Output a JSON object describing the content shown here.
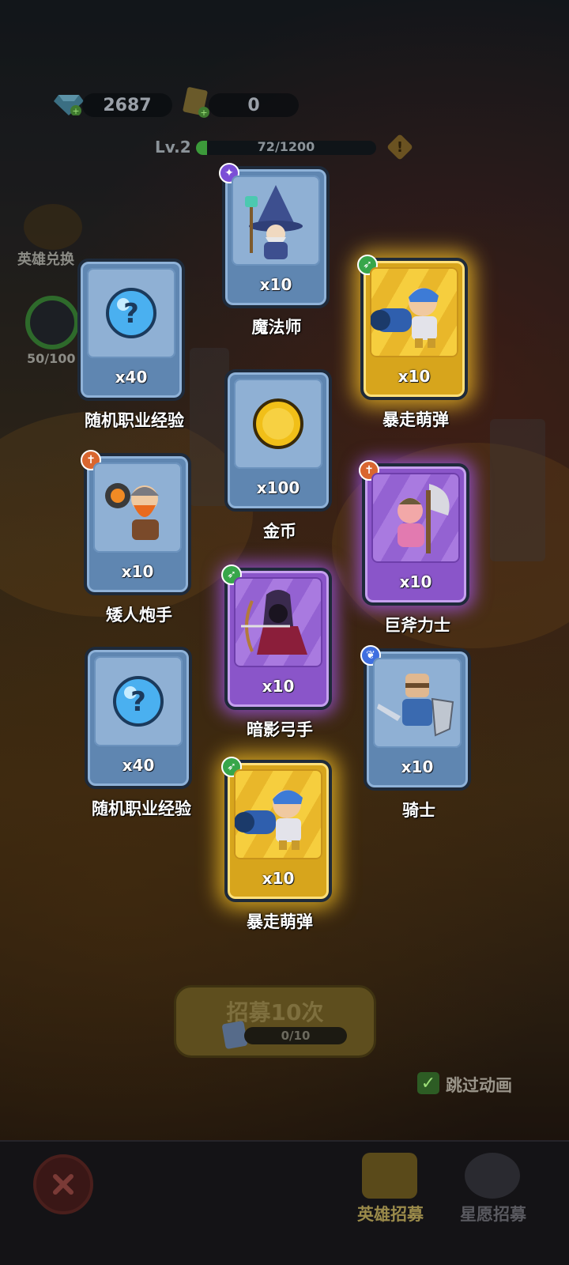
{
  "resources": {
    "gems": "2687",
    "tickets": "0"
  },
  "level": {
    "label": "Lv.2",
    "xp_text": "72/1200",
    "xp_fraction": 0.06
  },
  "side": {
    "hero_exchange_label": "英雄兑换",
    "star_progress_label": "50/100"
  },
  "cards": [
    {
      "name": "魔法师",
      "qty": "x10",
      "rarity": "blue",
      "badge": "wand-icon",
      "art": "wizard"
    },
    {
      "name": "随机职业经验",
      "qty": "x40",
      "rarity": "blue",
      "badge": "",
      "art": "mystery-orb"
    },
    {
      "name": "暴走萌弹",
      "qty": "x10",
      "rarity": "gold",
      "badge": "bow-icon",
      "art": "cannon-kid"
    },
    {
      "name": "金币",
      "qty": "x100",
      "rarity": "blue",
      "badge": "",
      "art": "gold-coin"
    },
    {
      "name": "矮人炮手",
      "qty": "x10",
      "rarity": "blue",
      "badge": "sword-icon",
      "art": "dwarf"
    },
    {
      "name": "巨斧力士",
      "qty": "x10",
      "rarity": "purple",
      "badge": "sword-icon",
      "art": "axe-warrior"
    },
    {
      "name": "暗影弓手",
      "qty": "x10",
      "rarity": "purple",
      "badge": "bow-icon",
      "art": "shadow-archer"
    },
    {
      "name": "随机职业经验",
      "qty": "x40",
      "rarity": "blue",
      "badge": "",
      "art": "mystery-orb"
    },
    {
      "name": "骑士",
      "qty": "x10",
      "rarity": "blue",
      "badge": "paw-icon",
      "art": "knight"
    },
    {
      "name": "暴走萌弹",
      "qty": "x10",
      "rarity": "gold",
      "badge": "bow-icon",
      "art": "cannon-kid"
    }
  ],
  "recruit": {
    "label": "招募10次",
    "progress": "0/10"
  },
  "skip_animation": {
    "label": "跳过动画",
    "checked": true
  },
  "tabs": {
    "hero_recruit": "英雄招募",
    "star_wish": "星愿招募"
  },
  "colors": {
    "gold": "#f6ce3e",
    "purple": "#9462d2",
    "blue": "#8fb0d4"
  }
}
